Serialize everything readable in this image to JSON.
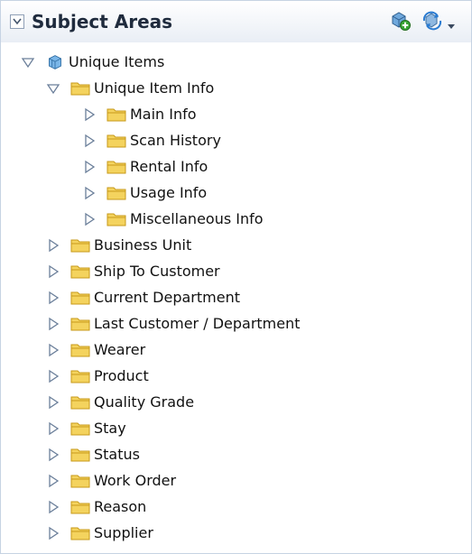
{
  "panel": {
    "title": "Subject Areas"
  },
  "tree": {
    "root": {
      "label": "Unique Items",
      "icon": "cube-icon",
      "expanded": true
    },
    "unique_item_info": {
      "label": "Unique Item Info",
      "expanded": true,
      "children": [
        {
          "label": "Main Info"
        },
        {
          "label": "Scan History"
        },
        {
          "label": "Rental Info"
        },
        {
          "label": "Usage Info"
        },
        {
          "label": "Miscellaneous Info"
        }
      ]
    },
    "items": [
      {
        "label": "Business Unit"
      },
      {
        "label": "Ship To Customer"
      },
      {
        "label": "Current Department"
      },
      {
        "label": "Last Customer / Department"
      },
      {
        "label": "Wearer"
      },
      {
        "label": "Product"
      },
      {
        "label": "Quality Grade"
      },
      {
        "label": "Stay"
      },
      {
        "label": "Status"
      },
      {
        "label": "Work Order"
      },
      {
        "label": "Reason"
      },
      {
        "label": "Supplier"
      }
    ]
  },
  "colors": {
    "folder": "#f4d35e",
    "folder_dark": "#c79a1a",
    "twisty": "#6b7f9a",
    "header_text": "#1f2b3d"
  }
}
